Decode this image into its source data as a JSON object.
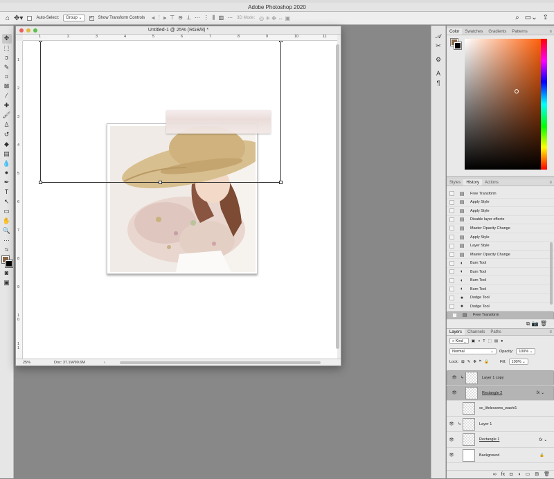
{
  "app": {
    "title": "Adobe Photoshop 2020"
  },
  "options_bar": {
    "auto_select_label": "Auto-Select:",
    "auto_select_value": "Group",
    "show_transform_label": "Show Transform Controls",
    "mode_3d_label": "3D Mode:"
  },
  "document": {
    "title": "Untitled-1 @ 25% (RGB/8) *",
    "zoom": "25%",
    "doc_size": "Doc: 37.1M/90.6M",
    "ruler_h": [
      "1",
      "2",
      "3",
      "4",
      "5",
      "6",
      "7",
      "8",
      "9",
      "10",
      "11"
    ],
    "ruler_v": [
      "1",
      "2",
      "3",
      "4",
      "5",
      "6",
      "7",
      "8",
      "9",
      "1 0",
      "1 1"
    ]
  },
  "color_panel": {
    "tabs": [
      "Color",
      "Swatches",
      "Gradients",
      "Patterns"
    ],
    "foreground": "#8b6542",
    "background": "#000000",
    "hue_color": "#ff5a00"
  },
  "history_panel": {
    "tabs": [
      "Styles",
      "History",
      "Actions"
    ],
    "items": [
      {
        "label": "Free Transform",
        "icon": "doc-icon"
      },
      {
        "label": "Apply Style",
        "icon": "doc-icon"
      },
      {
        "label": "Apply Style",
        "icon": "doc-icon"
      },
      {
        "label": "Disable layer effects",
        "icon": "doc-icon"
      },
      {
        "label": "Master Opacity Change",
        "icon": "doc-icon"
      },
      {
        "label": "Apply Style",
        "icon": "doc-icon"
      },
      {
        "label": "Layer Style",
        "icon": "doc-icon"
      },
      {
        "label": "Master Opacity Change",
        "icon": "doc-icon"
      },
      {
        "label": "Burn Tool",
        "icon": "burn-icon"
      },
      {
        "label": "Burn Tool",
        "icon": "burn-icon"
      },
      {
        "label": "Burn Tool",
        "icon": "burn-icon"
      },
      {
        "label": "Burn Tool",
        "icon": "burn-icon"
      },
      {
        "label": "Dodge Tool",
        "icon": "dodge-icon"
      },
      {
        "label": "Dodge Tool",
        "icon": "dodge-icon"
      },
      {
        "label": "Free Transform",
        "icon": "doc-icon"
      }
    ]
  },
  "layers_panel": {
    "tabs": [
      "Layers",
      "Channels",
      "Paths"
    ],
    "filter_kind": "Kind",
    "blend_mode": "Normal",
    "opacity_label": "Opacity:",
    "opacity_value": "100%",
    "lock_label": "Lock:",
    "fill_label": "Fill:",
    "fill_value": "100%",
    "layers": [
      {
        "name": "Layer 1 copy",
        "visible": true,
        "clipped": true,
        "fx": false,
        "selected": true,
        "underline": false,
        "thumb": "pattern"
      },
      {
        "name": "Rectangle 2",
        "visible": true,
        "clipped": false,
        "fx": true,
        "selected": true,
        "underline": true,
        "thumb": "pattern"
      },
      {
        "name": "sc_lifelessons_washi1",
        "visible": false,
        "clipped": false,
        "fx": false,
        "selected": false,
        "underline": false,
        "thumb": "pattern"
      },
      {
        "name": "Layer 1",
        "visible": true,
        "clipped": true,
        "fx": false,
        "selected": false,
        "underline": false,
        "thumb": "pattern"
      },
      {
        "name": "Rectangle 1",
        "visible": true,
        "clipped": false,
        "fx": true,
        "selected": false,
        "underline": true,
        "thumb": "pattern"
      },
      {
        "name": "Background",
        "visible": true,
        "clipped": false,
        "fx": false,
        "selected": false,
        "underline": false,
        "thumb": "white",
        "locked": true
      }
    ]
  }
}
